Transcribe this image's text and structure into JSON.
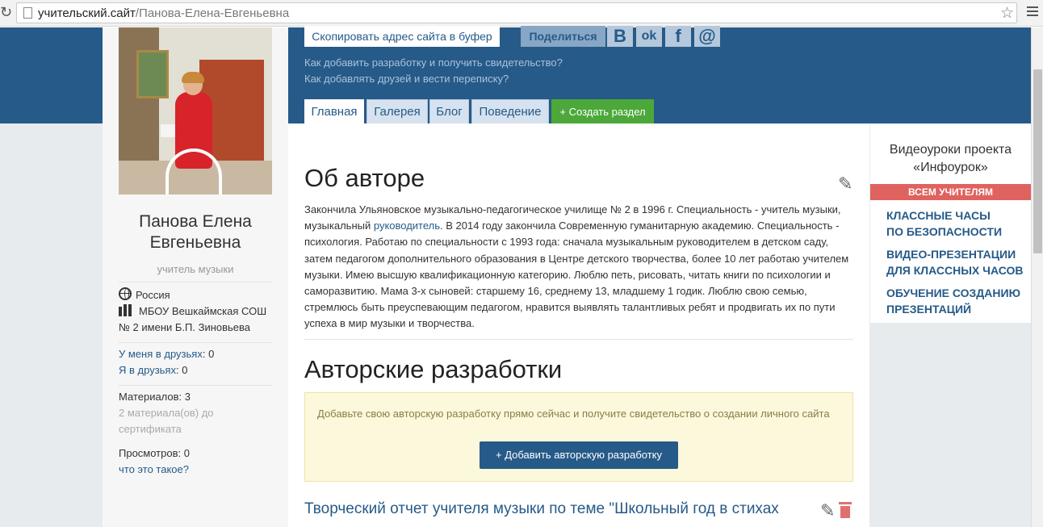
{
  "browser": {
    "url_host": "учительский.сайт",
    "url_path": "/Панова-Елена-Евгеньевна"
  },
  "header": {
    "copy_button": "Скопировать адрес сайта в буфер",
    "share_label": "Поделиться",
    "social": [
      "В",
      "ok",
      "f",
      "@"
    ],
    "help_links": [
      "Как добавить разработку и получить свидетельство?",
      "Как добавлять друзей и вести переписку?"
    ]
  },
  "tabs": [
    {
      "label": "Главная"
    },
    {
      "label": "Галерея"
    },
    {
      "label": "Блог"
    },
    {
      "label": "Поведение"
    },
    {
      "label": "+ Создать раздел"
    }
  ],
  "profile": {
    "name_line1": "Панова Елена",
    "name_line2": "Евгеньевна",
    "job": "учитель музыки",
    "country": "Россия",
    "school_line1": "МБОУ Вешкаймская СОШ",
    "school_line2": "№ 2 имени Б.П. Зиновьева",
    "friends_mine_label": "У меня в друзьях",
    "friends_mine_value": ": 0",
    "friends_in_label": "Я в друзьях",
    "friends_in_value": ": 0",
    "materials": "Материалов: 3",
    "cert_line1": "2 материала(ов) до",
    "cert_line2": "сертификата",
    "views": "Просмотров: 0",
    "what_is": "что это такое?"
  },
  "about": {
    "heading": "Об авторе",
    "text_before_link": "Закончила Ульяновское музыкально-педагогическое училище № 2 в 1996 г. Специальность - учитель музыки, музыкальный ",
    "link": "руководитель",
    "text_after_link": ". В 2014 году закончила Современную гуманитарную академию. Специальность - психология. Работаю по специальности с 1993 года: сначала музыкальным руководителем в детском саду, затем педагогом дополнительного образования в Центре детского творчества, более 10 лет работаю учителем музыки. Имею высшую квалификационную категорию. Люблю петь, рисовать, читать книги по психологии и саморазвитию. Мама 3-х сыновей: старшему 16, среднему 13, младшему 1 годик. Люблю свою семью, стремлюсь быть преуспевающим педагогом, нравится выявлять талантливых ребят и продвигать их по пути успеха в мир музыки и творчества."
  },
  "works": {
    "heading": "Авторские разработки",
    "notice": "Добавьте свою авторскую разработку прямо сейчас и получите свидетельство о создании личного сайта",
    "add_button": "+ Добавить авторскую разработку",
    "first_title": "Творческий отчет учителя музыки по теме \"Школьный год в стихах"
  },
  "sidebar": {
    "title_line1": "Видеоуроки проекта",
    "title_line2": "«Инфоурок»",
    "all_teachers": "ВСЕМ УЧИТЕЛЯМ",
    "links": [
      {
        "line1": "КЛАССНЫЕ ЧАСЫ",
        "line2": "ПО БЕЗОПАСНОСТИ"
      },
      {
        "line1": "ВИДЕО-ПРЕЗЕНТАЦИИ",
        "line2": "ДЛЯ КЛАССНЫХ ЧАСОВ"
      },
      {
        "line1": "ОБУЧЕНИЕ СОЗДАНИЮ",
        "line2": "ПРЕЗЕНТАЦИЙ"
      }
    ]
  },
  "colors": {
    "brand_blue": "#265a88",
    "create_green": "#4ca83a",
    "accent_red": "#e0625e"
  }
}
